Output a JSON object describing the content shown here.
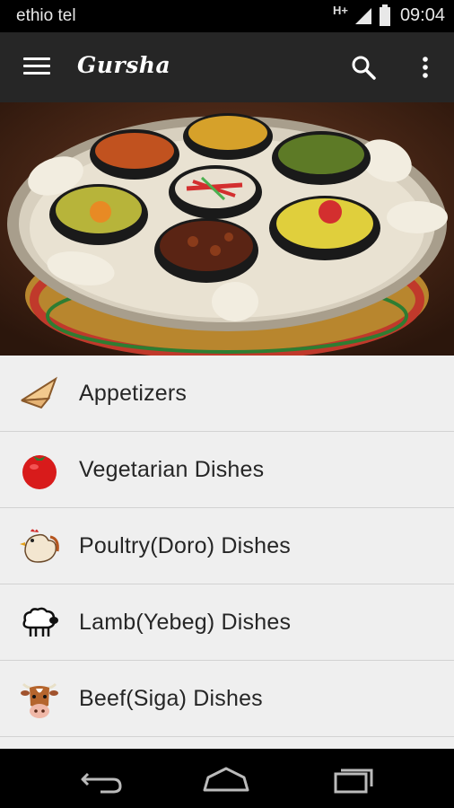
{
  "status_bar": {
    "carrier": "ethio tel",
    "network": "H+",
    "time": "09:04"
  },
  "app_bar": {
    "title": "Gursha"
  },
  "categories": [
    {
      "label": "Appetizers",
      "icon": "samosa-icon"
    },
    {
      "label": "Vegetarian Dishes",
      "icon": "tomato-icon"
    },
    {
      "label": "Poultry(Doro) Dishes",
      "icon": "chicken-icon"
    },
    {
      "label": "Lamb(Yebeg) Dishes",
      "icon": "sheep-icon"
    },
    {
      "label": "Beef(Siga) Dishes",
      "icon": "cow-icon"
    }
  ],
  "colors": {
    "app_bar": "#262626",
    "list_bg": "#efefef",
    "divider": "#d2d2d2",
    "text": "#262626"
  }
}
